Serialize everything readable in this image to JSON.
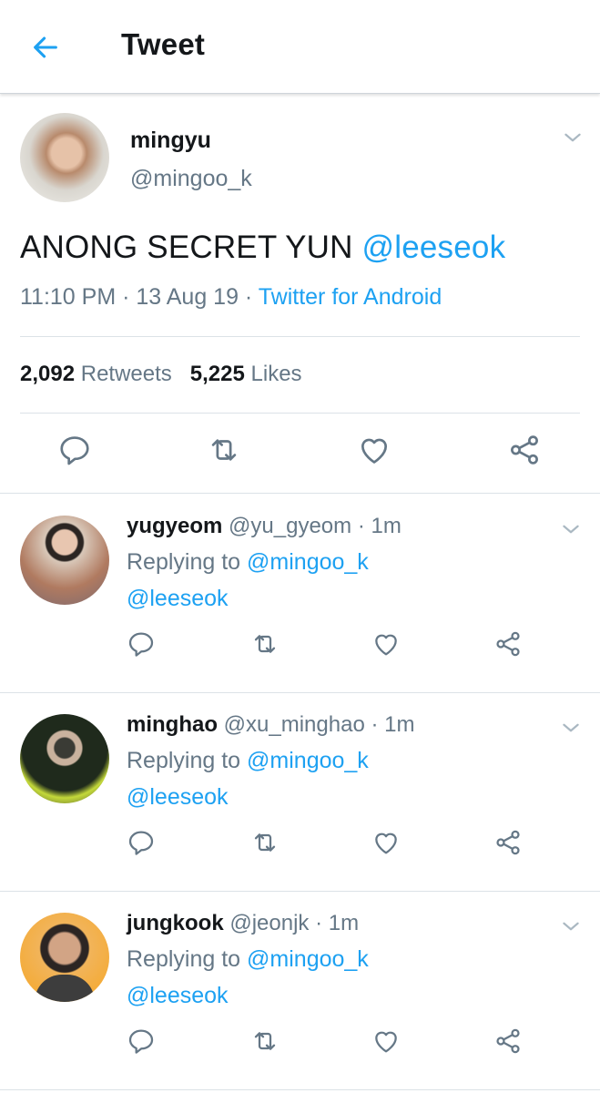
{
  "header": {
    "title": "Tweet",
    "back_icon": "back-arrow-icon"
  },
  "colors": {
    "accent": "#1da1f2",
    "secondary_text": "#657786",
    "primary_text": "#14171a"
  },
  "main_tweet": {
    "name": "mingyu",
    "handle": "@mingoo_k",
    "text": "ANONG SECRET YUN ",
    "mention": "@leeseok",
    "time": "11:10 PM · 13 Aug 19 · ",
    "source": "Twitter for Android",
    "retweets_count": "2,092",
    "retweets_label": "Retweets",
    "likes_count": "5,225",
    "likes_label": "Likes"
  },
  "replies": [
    {
      "name": "yugyeom",
      "handle": "@yu_gyeom",
      "time": "· 1m",
      "replying_label": "Replying to ",
      "replying_to": "@mingoo_k",
      "text": "@leeseok"
    },
    {
      "name": "minghao",
      "handle": "@xu_minghao",
      "time": "· 1m",
      "replying_label": "Replying to ",
      "replying_to": "@mingoo_k",
      "text": "@leeseok"
    },
    {
      "name": "jungkook",
      "handle": "@jeonjk",
      "time": "· 1m",
      "replying_label": "Replying to ",
      "replying_to": "@mingoo_k",
      "text": "@leeseok"
    }
  ],
  "action_icons": [
    "reply-icon",
    "retweet-icon",
    "like-icon",
    "share-icon"
  ]
}
